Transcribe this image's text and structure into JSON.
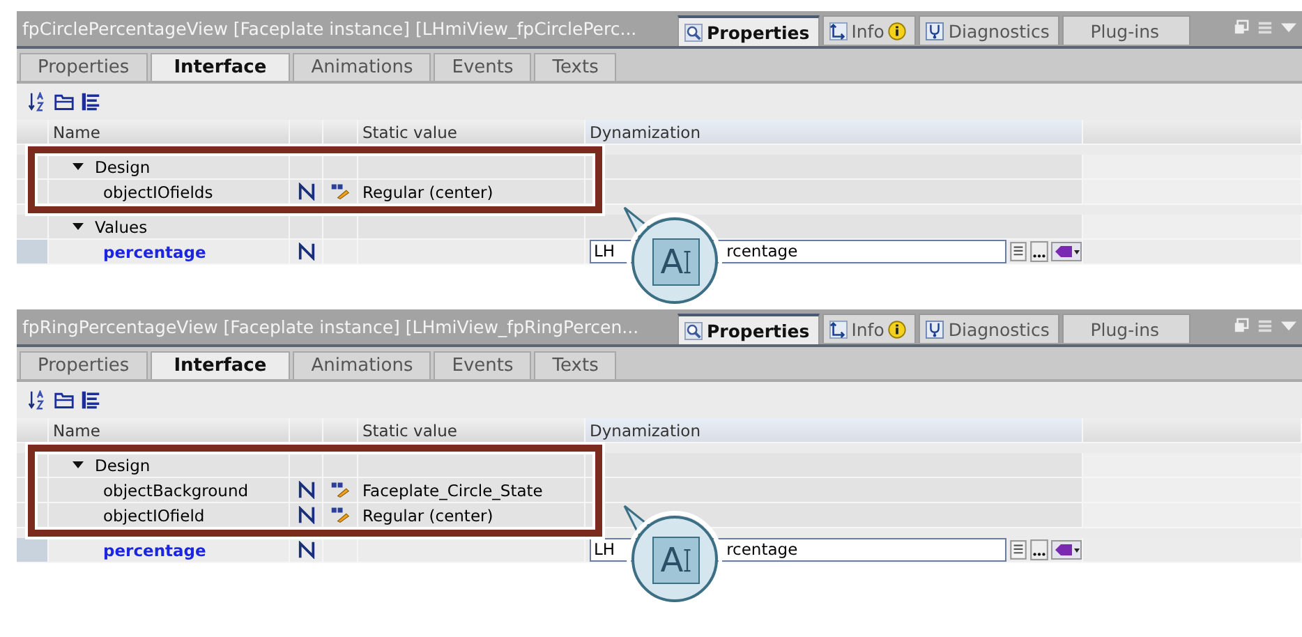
{
  "panels": [
    {
      "title": "fpCirclePercentageView  [Faceplate instance]  [LHmiView_fpCirclePerc...",
      "inspector_tabs": [
        {
          "label": "Properties",
          "selected": true,
          "kind": "properties"
        },
        {
          "label": "Info",
          "selected": false,
          "kind": "info"
        },
        {
          "label": "Diagnostics",
          "selected": false,
          "kind": "diagnostics"
        },
        {
          "label": "Plug-ins",
          "selected": false,
          "kind": "plain"
        }
      ],
      "tabs": [
        {
          "label": "Properties",
          "selected": false
        },
        {
          "label": "Interface",
          "selected": true
        },
        {
          "label": "Animations",
          "selected": false
        },
        {
          "label": "Events",
          "selected": false
        },
        {
          "label": "Texts",
          "selected": false
        }
      ],
      "columns": [
        "Name",
        "Static value",
        "Dynamization"
      ],
      "highlighted_rows": [
        {
          "kind": "group",
          "name": "Design",
          "expanded": true
        },
        {
          "kind": "property",
          "name": "objectIOfields",
          "static_value": "Regular (center)"
        }
      ],
      "rows": [
        {
          "kind": "group",
          "name": "Values",
          "expanded": true
        },
        {
          "kind": "input",
          "name": "percentage",
          "dynamization": [
            "LH",
            "rcentage"
          ]
        }
      ],
      "callout": {
        "text": "A"
      }
    },
    {
      "title": "fpRingPercentageView  [Faceplate instance]  [LHmiView_fpRingPercen...",
      "inspector_tabs": [
        {
          "label": "Properties",
          "selected": true,
          "kind": "properties"
        },
        {
          "label": "Info",
          "selected": false,
          "kind": "info"
        },
        {
          "label": "Diagnostics",
          "selected": false,
          "kind": "diagnostics"
        },
        {
          "label": "Plug-ins",
          "selected": false,
          "kind": "plain"
        }
      ],
      "tabs": [
        {
          "label": "Properties",
          "selected": false
        },
        {
          "label": "Interface",
          "selected": true
        },
        {
          "label": "Animations",
          "selected": false
        },
        {
          "label": "Events",
          "selected": false
        },
        {
          "label": "Texts",
          "selected": false
        }
      ],
      "columns": [
        "Name",
        "Static value",
        "Dynamization"
      ],
      "highlighted_rows": [
        {
          "kind": "group",
          "name": "Design",
          "expanded": true
        },
        {
          "kind": "property",
          "name": "objectBackground",
          "static_value": "Faceplate_Circle_State"
        },
        {
          "kind": "property",
          "name": "objectIOfield",
          "static_value": "Regular (center)"
        }
      ],
      "rows": [
        {
          "kind": "input",
          "name": "percentage",
          "dynamization": [
            "LH",
            "rcentage"
          ]
        }
      ],
      "callout": {
        "text": "A"
      }
    }
  ]
}
